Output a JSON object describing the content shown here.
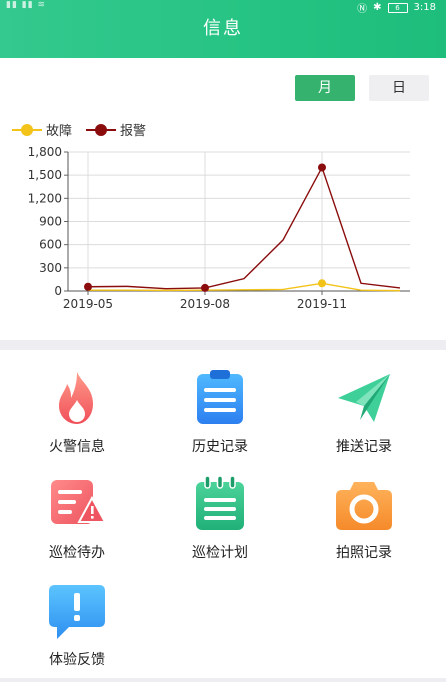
{
  "status_bar": {
    "left": "▮▮ ▮▮ ≋",
    "time": "3:18",
    "battery": "6"
  },
  "header": {
    "title": "信息"
  },
  "period_toggle": {
    "month": "月",
    "day": "日"
  },
  "colors": {
    "brand": "#22c07f",
    "fault": "#f3c31a",
    "alarm": "#8a0c0c",
    "active_btn": "#36b26f"
  },
  "chart_data": {
    "type": "line",
    "x_tick_labels": [
      "2019-05",
      "2019-08",
      "2019-11"
    ],
    "y_tick_labels": [
      "0",
      "300",
      "600",
      "900",
      "1,200",
      "1,500",
      "1,800"
    ],
    "ylim": [
      0,
      1800
    ],
    "x": [
      "2019-05",
      "2019-06",
      "2019-07",
      "2019-08",
      "2019-09",
      "2019-10",
      "2019-11",
      "2019-12",
      "2020-01"
    ],
    "series": [
      {
        "name": "故障",
        "color": "#f3c31a",
        "values": [
          10,
          10,
          8,
          10,
          15,
          20,
          100,
          10,
          5
        ]
      },
      {
        "name": "报警",
        "color": "#8a0c0c",
        "values": [
          55,
          60,
          30,
          40,
          160,
          660,
          1600,
          100,
          40
        ]
      }
    ],
    "marked_points": [
      {
        "series": 1,
        "index": 0
      },
      {
        "series": 1,
        "index": 3
      },
      {
        "series": 1,
        "index": 6
      },
      {
        "series": 0,
        "index": 6
      }
    ],
    "grid": true,
    "legend_position": "top-left"
  },
  "menu": [
    {
      "label": "火警信息",
      "icon": "fire-icon"
    },
    {
      "label": "历史记录",
      "icon": "clipboard-icon"
    },
    {
      "label": "推送记录",
      "icon": "paper-plane-icon"
    },
    {
      "label": "巡检待办",
      "icon": "warning-list-icon"
    },
    {
      "label": "巡检计划",
      "icon": "calendar-icon"
    },
    {
      "label": "拍照记录",
      "icon": "camera-icon"
    },
    {
      "label": "体验反馈",
      "icon": "feedback-icon"
    }
  ]
}
